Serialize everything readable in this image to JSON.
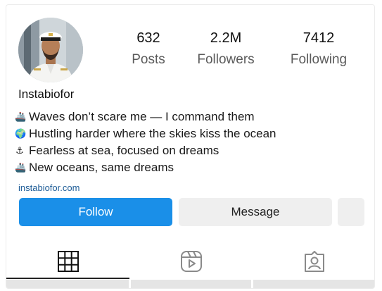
{
  "profile": {
    "username": "Instabiofor",
    "avatar_icon": "profile-photo-captain",
    "stats": {
      "posts": {
        "value": "632",
        "label": "Posts"
      },
      "followers": {
        "value": "2.2M",
        "label": "Followers"
      },
      "following": {
        "value": "7412",
        "label": "Following"
      }
    },
    "bio": [
      {
        "emoji": "🚢",
        "icon": "ship-icon",
        "text": "Waves don’t scare me — I command them"
      },
      {
        "emoji": "🌍",
        "icon": "globe-icon",
        "text": "Hustling harder where the skies kiss the ocean"
      },
      {
        "emoji": "⚓",
        "icon": "anchor-icon",
        "text": "Fearless at sea, focused on dreams"
      },
      {
        "emoji": "🚢",
        "icon": "ship-icon",
        "text": "New oceans, same dreams"
      }
    ],
    "website": "instabiofor.com"
  },
  "actions": {
    "follow_label": "Follow",
    "message_label": "Message"
  },
  "tabs": [
    {
      "name": "posts-grid",
      "icon": "grid-icon",
      "active": true
    },
    {
      "name": "reels",
      "icon": "reels-icon",
      "active": false
    },
    {
      "name": "tagged",
      "icon": "tagged-user-icon",
      "active": false
    }
  ],
  "colors": {
    "follow_button": "#1a8fe8",
    "secondary_button": "#efefef",
    "link": "#1d5c97",
    "text": "#262626"
  }
}
